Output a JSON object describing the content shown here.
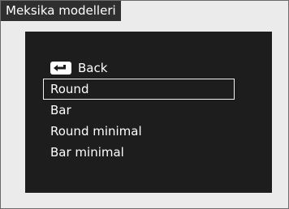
{
  "title": "Meksika modelleri",
  "menu": {
    "back_label": "Back",
    "selected_index": 1,
    "items": [
      "Round",
      "Bar",
      "Round minimal",
      "Bar minimal"
    ]
  },
  "icons": {
    "back": "return-arrow-icon"
  },
  "colors": {
    "screen_background": "#1d1d1d",
    "text": "#ffffff",
    "title_tab": "#2f2f2f",
    "frame": "#ebebeb"
  }
}
